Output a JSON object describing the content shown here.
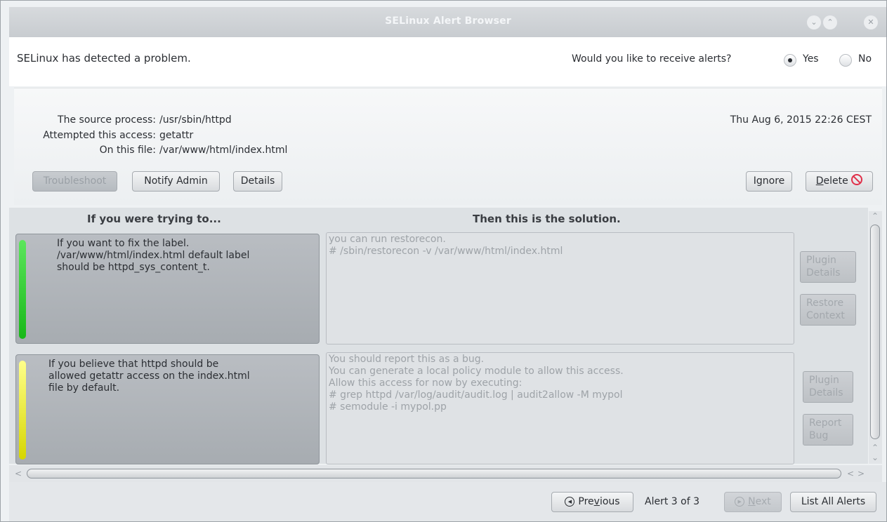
{
  "window": {
    "title": "SELinux Alert Browser",
    "controls": {
      "minimize": "⌄",
      "maximize": "⌃",
      "close": "✕"
    }
  },
  "header": {
    "message": "SELinux has detected a problem.",
    "alerts_question": "Would you like to receive alerts?",
    "option_yes": "Yes",
    "option_no": "No",
    "selected": "Yes"
  },
  "summary": {
    "source_label": "The source process:",
    "source_value": "/usr/sbin/httpd",
    "access_label": "Attempted this access:",
    "access_value": "getattr",
    "file_label": "On this file:",
    "file_value": "/var/www/html/index.html",
    "datetime": "Thu Aug  6, 2015 22:26 CEST"
  },
  "toolbar": {
    "troubleshoot": "Troubleshoot",
    "notify_admin": "Notify Admin",
    "details": "Details",
    "ignore": "Ignore",
    "delete_prefix": "D",
    "delete_rest": "elete",
    "delete_icon": "⃠"
  },
  "columns": {
    "left": "If you were trying to...",
    "right": "Then this is the solution."
  },
  "solutions": [
    {
      "bar_color": "#22c922",
      "trying_lines": [
        "If you want to fix the label.",
        "/var/www/html/index.html default label",
        "should be httpd_sys_content_t."
      ],
      "solution_lines": [
        "you can run restorecon.",
        "# /sbin/restorecon -v /var/www/html/index.html"
      ],
      "buttons": [
        [
          "Plugin",
          "Details"
        ],
        [
          "Restore",
          "Context"
        ]
      ]
    },
    {
      "bar_color": "#e6e600",
      "trying_lines": [
        "If you believe that httpd should be",
        "allowed getattr access on the index.html",
        "file by default."
      ],
      "solution_lines": [
        "You should report this as a bug.",
        "You can generate a local policy module to allow this access.",
        "Allow this access for now by executing:",
        "# grep httpd /var/log/audit/audit.log | audit2allow -M mypol",
        "# semodule -i mypol.pp"
      ],
      "buttons": [
        [
          "Plugin",
          "Details"
        ],
        [
          "Report",
          "Bug"
        ]
      ]
    }
  ],
  "footer": {
    "previous_a": "Pre",
    "previous_u": "v",
    "previous_b": "ious",
    "alert_count": "Alert 3 of 3",
    "next_u": "N",
    "next_b": "ext",
    "list_all": "List All Alerts"
  }
}
